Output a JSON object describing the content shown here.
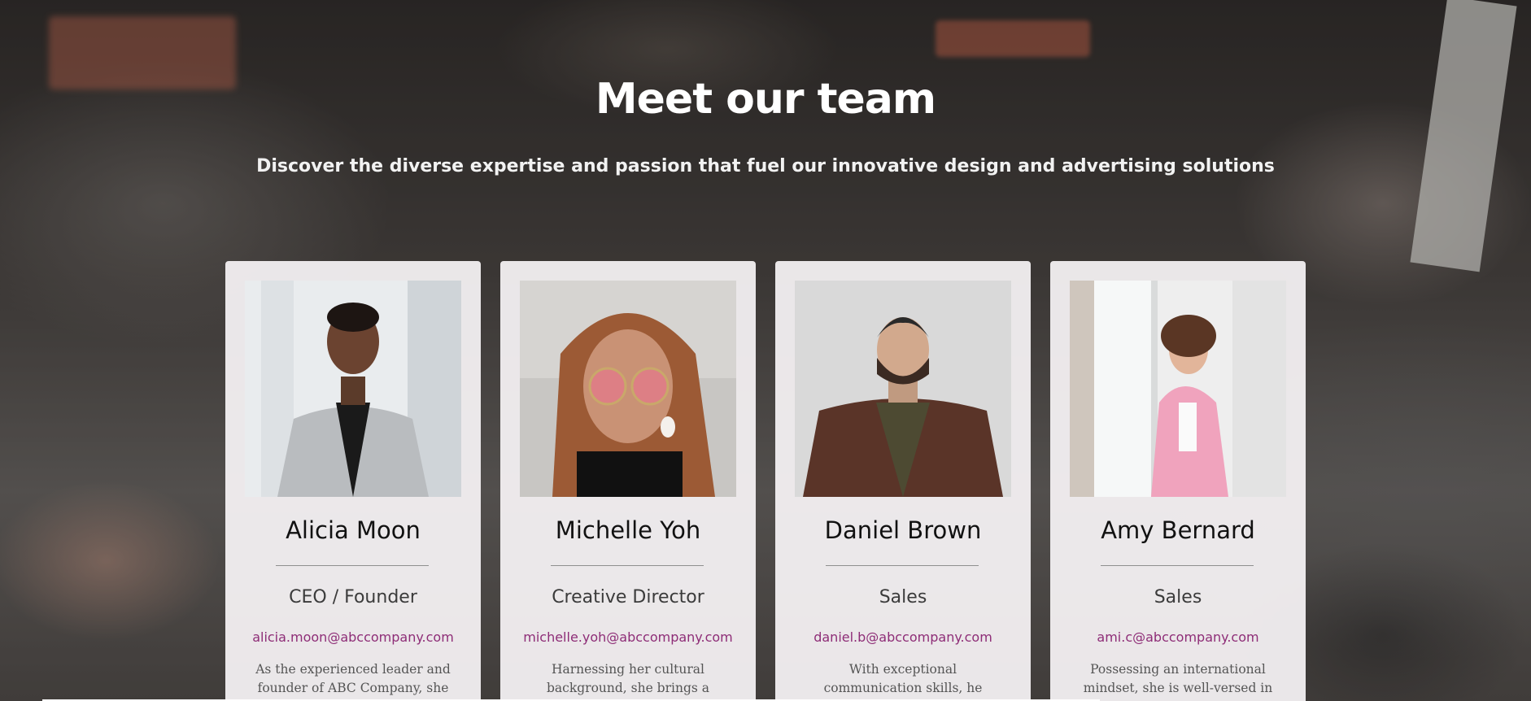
{
  "header": {
    "title": "Meet our team",
    "subtitle": "Discover the diverse expertise and passion that fuel our innovative design and advertising solutions"
  },
  "team": [
    {
      "name": "Alicia Moon",
      "role": "CEO / Founder",
      "email": "alicia.moon@abccompany.com",
      "bio": "As the experienced leader and founder of ABC Company, she"
    },
    {
      "name": "Michelle Yoh",
      "role": "Creative Director",
      "email": "michelle.yoh@abccompany.com",
      "bio": "Harnessing her cultural background, she brings a unique perspective to"
    },
    {
      "name": "Daniel Brown",
      "role": "Sales",
      "email": "daniel.b@abccompany.com",
      "bio": "With exceptional communication skills, he understands clients' needs"
    },
    {
      "name": "Amy Bernard",
      "role": "Sales",
      "email": "ami.c@abccompany.com",
      "bio": "Possessing an international mindset, she is well-versed in marketing"
    }
  ],
  "colors": {
    "accent_link": "#8e2d77",
    "card_bg": "#f8f4f6",
    "title_text": "#ffffff"
  }
}
